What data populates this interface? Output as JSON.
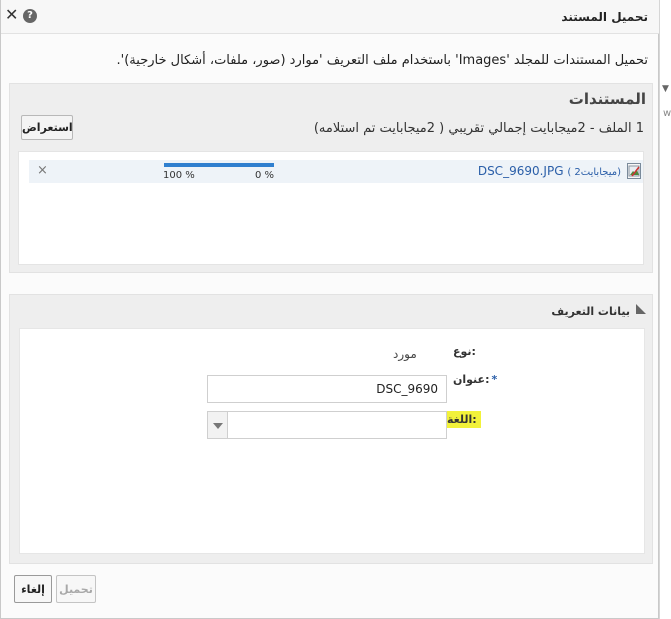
{
  "dialog": {
    "title": "تحميل المستند",
    "help_icon": "?",
    "close_icon": "✕"
  },
  "description": "تحميل المستندات للمجلد 'Images' باستخدام ملف التعريف 'موارد (صور، ملفات، أشكال خارجية)'.",
  "documents": {
    "heading": "المستندات",
    "browse_label": "استعراض",
    "summary": "1 الملف - 2ميجابايت إجمالي تقريبي ( 2ميجابايت تم استلامه)",
    "files": [
      {
        "name": "DSC_9690.JPG",
        "size": "( 2ميجابايت)",
        "progress": 1.0,
        "progress_start_label": "0 %",
        "progress_end_label": "100 %",
        "remove_icon": "×"
      }
    ]
  },
  "metadata": {
    "heading": "بيانات التعريف",
    "type_label": "نوع:",
    "type_value": "مورد",
    "title_label": "عنوان:",
    "title_required_mark": "*",
    "title_value": "DSC_9690",
    "language_label": "اللغة:",
    "language_value": ""
  },
  "footer": {
    "cancel_label": "إلغاء",
    "upload_label": "تحميل"
  },
  "colors": {
    "highlight": "#f2f23a",
    "link": "#2a5ea8",
    "progress": "#2f7fcf"
  }
}
